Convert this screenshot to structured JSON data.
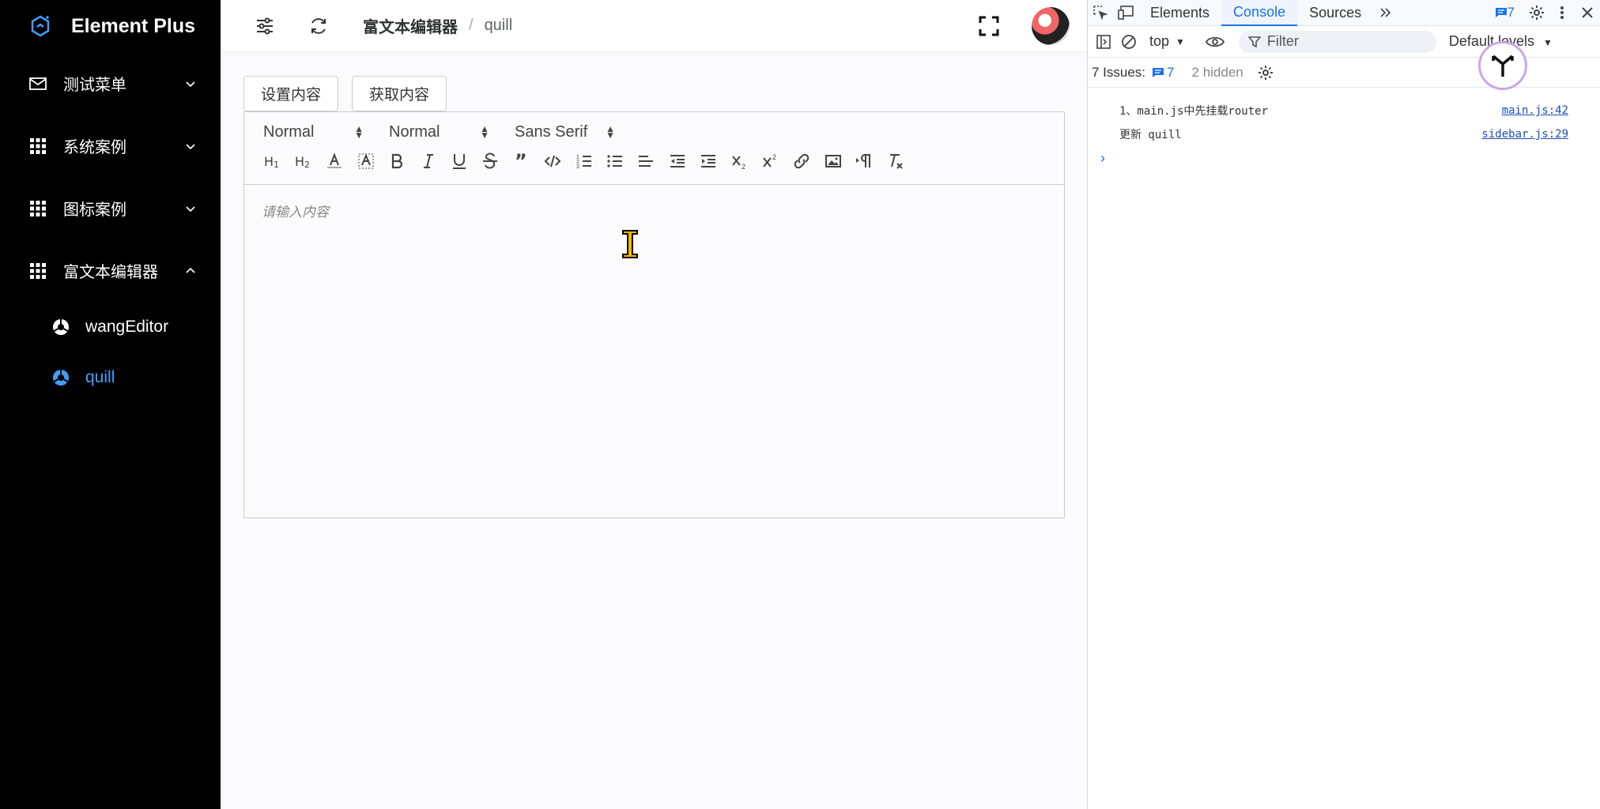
{
  "sidebar": {
    "app_title": "Element Plus",
    "menu": [
      {
        "label": "测试菜单",
        "icon": "mail-icon"
      },
      {
        "label": "系统案例",
        "icon": "grid-icon"
      },
      {
        "label": "图标案例",
        "icon": "grid-icon"
      },
      {
        "label": "富文本编辑器",
        "icon": "grid-icon"
      }
    ],
    "submenu": [
      {
        "label": "wangEditor",
        "icon": "chrome-icon",
        "active": false
      },
      {
        "label": "quill",
        "icon": "chrome-icon",
        "active": true
      }
    ],
    "active_color": "#409eff"
  },
  "header": {
    "breadcrumb_parent": "富文本编辑器",
    "breadcrumb_separator": "/",
    "breadcrumb_current": "quill"
  },
  "actions": {
    "set_content": "设置内容",
    "get_content": "获取内容"
  },
  "editor": {
    "size_picker": "Normal",
    "header_picker": "Normal",
    "font_picker": "Sans Serif",
    "placeholder": "请输入内容",
    "tools": [
      "h1",
      "h2",
      "color",
      "background",
      "bold",
      "italic",
      "underline",
      "strike",
      "blockquote",
      "code-block",
      "ordered-list",
      "bullet-list",
      "align",
      "indent-decrease",
      "indent-increase",
      "subscript",
      "superscript",
      "link",
      "image",
      "direction",
      "clean"
    ]
  },
  "devtools": {
    "tabs": [
      "Elements",
      "Console",
      "Sources"
    ],
    "active_tab": "Console",
    "issue_count": "7",
    "context": "top",
    "filter_placeholder": "Filter",
    "levels": "Default levels",
    "issues_label": "7 Issues:",
    "issues_count": "7",
    "hidden": "2 hidden",
    "logs": [
      {
        "text": "1、main.js中先挂载router",
        "source": "main.js:42"
      },
      {
        "text": "更新 quill",
        "source": "sidebar.js:29"
      }
    ],
    "prompt": "›"
  }
}
